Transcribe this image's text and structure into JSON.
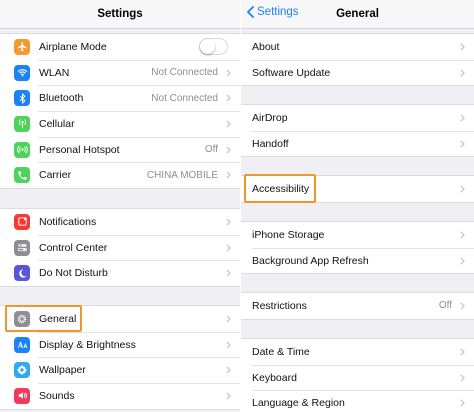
{
  "left": {
    "title": "Settings",
    "groups": [
      [
        {
          "label": "Airplane Mode",
          "icon": "airplane-icon",
          "color": "#f29a30",
          "toggle": true
        },
        {
          "label": "WLAN",
          "icon": "wifi-icon",
          "color": "#1c82fa",
          "value": "Not Connected"
        },
        {
          "label": "Bluetooth",
          "icon": "bluetooth-icon",
          "color": "#1c82fa",
          "value": "Not Connected"
        },
        {
          "label": "Cellular",
          "icon": "cellular-icon",
          "color": "#4fd25a"
        },
        {
          "label": "Personal Hotspot",
          "icon": "hotspot-icon",
          "color": "#4fd25a",
          "value": "Off"
        },
        {
          "label": "Carrier",
          "icon": "phone-icon",
          "color": "#4fd25a",
          "value": "CHINA MOBILE"
        }
      ],
      [
        {
          "label": "Notifications",
          "icon": "notifications-icon",
          "color": "#f23c32"
        },
        {
          "label": "Control Center",
          "icon": "control-center-icon",
          "color": "#8e8e93"
        },
        {
          "label": "Do Not Disturb",
          "icon": "moon-icon",
          "color": "#5a57d6"
        }
      ],
      [
        {
          "label": "General",
          "icon": "gear-icon",
          "color": "#8e8e93"
        },
        {
          "label": "Display & Brightness",
          "icon": "display-icon",
          "color": "#1c82fa"
        },
        {
          "label": "Wallpaper",
          "icon": "wallpaper-icon",
          "color": "#2daaf0"
        },
        {
          "label": "Sounds",
          "icon": "sounds-icon",
          "color": "#f23b5a"
        }
      ]
    ]
  },
  "right": {
    "back_label": "Settings",
    "title": "General",
    "groups": [
      [
        {
          "label": "About"
        },
        {
          "label": "Software Update"
        }
      ],
      [
        {
          "label": "AirDrop"
        },
        {
          "label": "Handoff"
        }
      ],
      [
        {
          "label": "Accessibility"
        }
      ],
      [
        {
          "label": "iPhone Storage"
        },
        {
          "label": "Background App Refresh"
        }
      ],
      [
        {
          "label": "Restrictions",
          "value": "Off"
        }
      ],
      [
        {
          "label": "Date & Time"
        },
        {
          "label": "Keyboard"
        },
        {
          "label": "Language & Region"
        }
      ]
    ]
  },
  "highlight_color": "#f0962e"
}
